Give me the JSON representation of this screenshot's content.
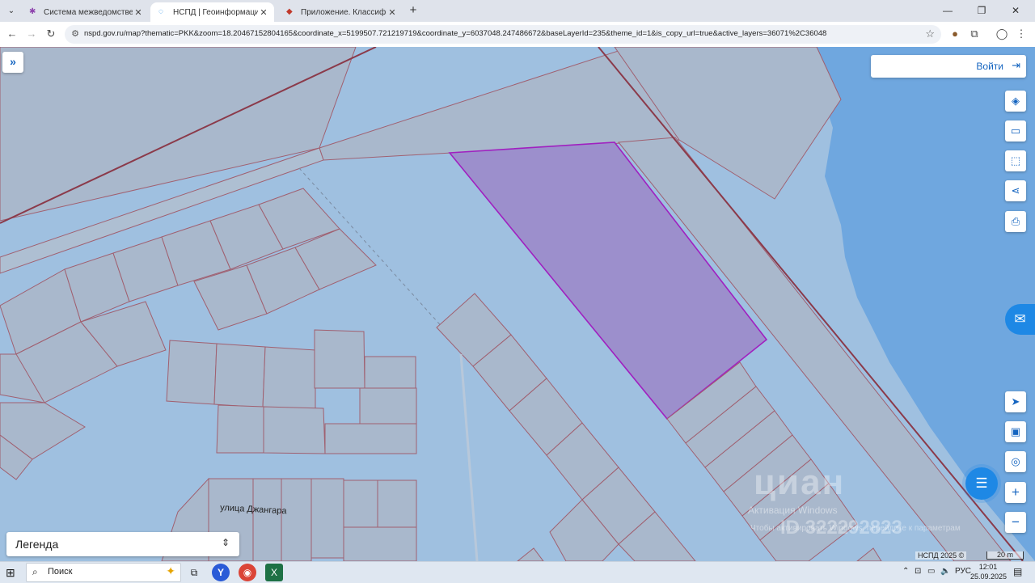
{
  "browser": {
    "tabs": [
      {
        "title": "Система межведомственного",
        "favicon": "site-icon-purple"
      },
      {
        "title": "НСПД | Геоинформационный",
        "favicon": "site-icon-blue"
      },
      {
        "title": "Приложение. Классификатор",
        "favicon": "site-icon-red"
      }
    ],
    "new_tab_label": "+",
    "tab_close_glyph": "✕",
    "window_controls": [
      "—",
      "❐",
      "✕"
    ],
    "url": "nspd.gov.ru/map?thematic=PKK&zoom=18.20467152804165&coordinate_x=5199507.721219719&coordinate_y=6037048.247486672&baseLayerId=235&theme_id=1&is_copy_url=true&active_layers=36071%2C36048"
  },
  "map": {
    "login_label": "Войти",
    "street_label": "улица Джангара",
    "legend_label": "Легенда",
    "attribution": "НСПД 2025 ©",
    "scale_label": "20 m",
    "selected_parcel_color": "#9c8fcc",
    "water_color": "#6fa7df",
    "land_color": "#9fc0e0",
    "watermark": {
      "brand": "циан",
      "id_text": "ID 322292823",
      "activation_line1": "Активация Windows",
      "activation_line2": "Чтобы активировать Windows, перейдите к параметрам"
    },
    "tools": [
      {
        "name": "layers-icon",
        "glyph": "◈"
      },
      {
        "name": "ruler-icon",
        "glyph": "▭"
      },
      {
        "name": "area-select-icon",
        "glyph": "⬚"
      },
      {
        "name": "share-icon",
        "glyph": "⋖"
      },
      {
        "name": "print-icon",
        "glyph": "⎙"
      },
      {
        "name": "locate-icon",
        "glyph": "➤"
      },
      {
        "name": "minimap-icon",
        "glyph": "▣"
      },
      {
        "name": "target-icon",
        "glyph": "◎"
      },
      {
        "name": "zoom-in-icon",
        "glyph": "+"
      },
      {
        "name": "zoom-out-icon",
        "glyph": "−"
      }
    ]
  },
  "taskbar": {
    "search_label": "Поиск",
    "language": "РУС",
    "time": "12:01",
    "date": "25.09.2025"
  }
}
